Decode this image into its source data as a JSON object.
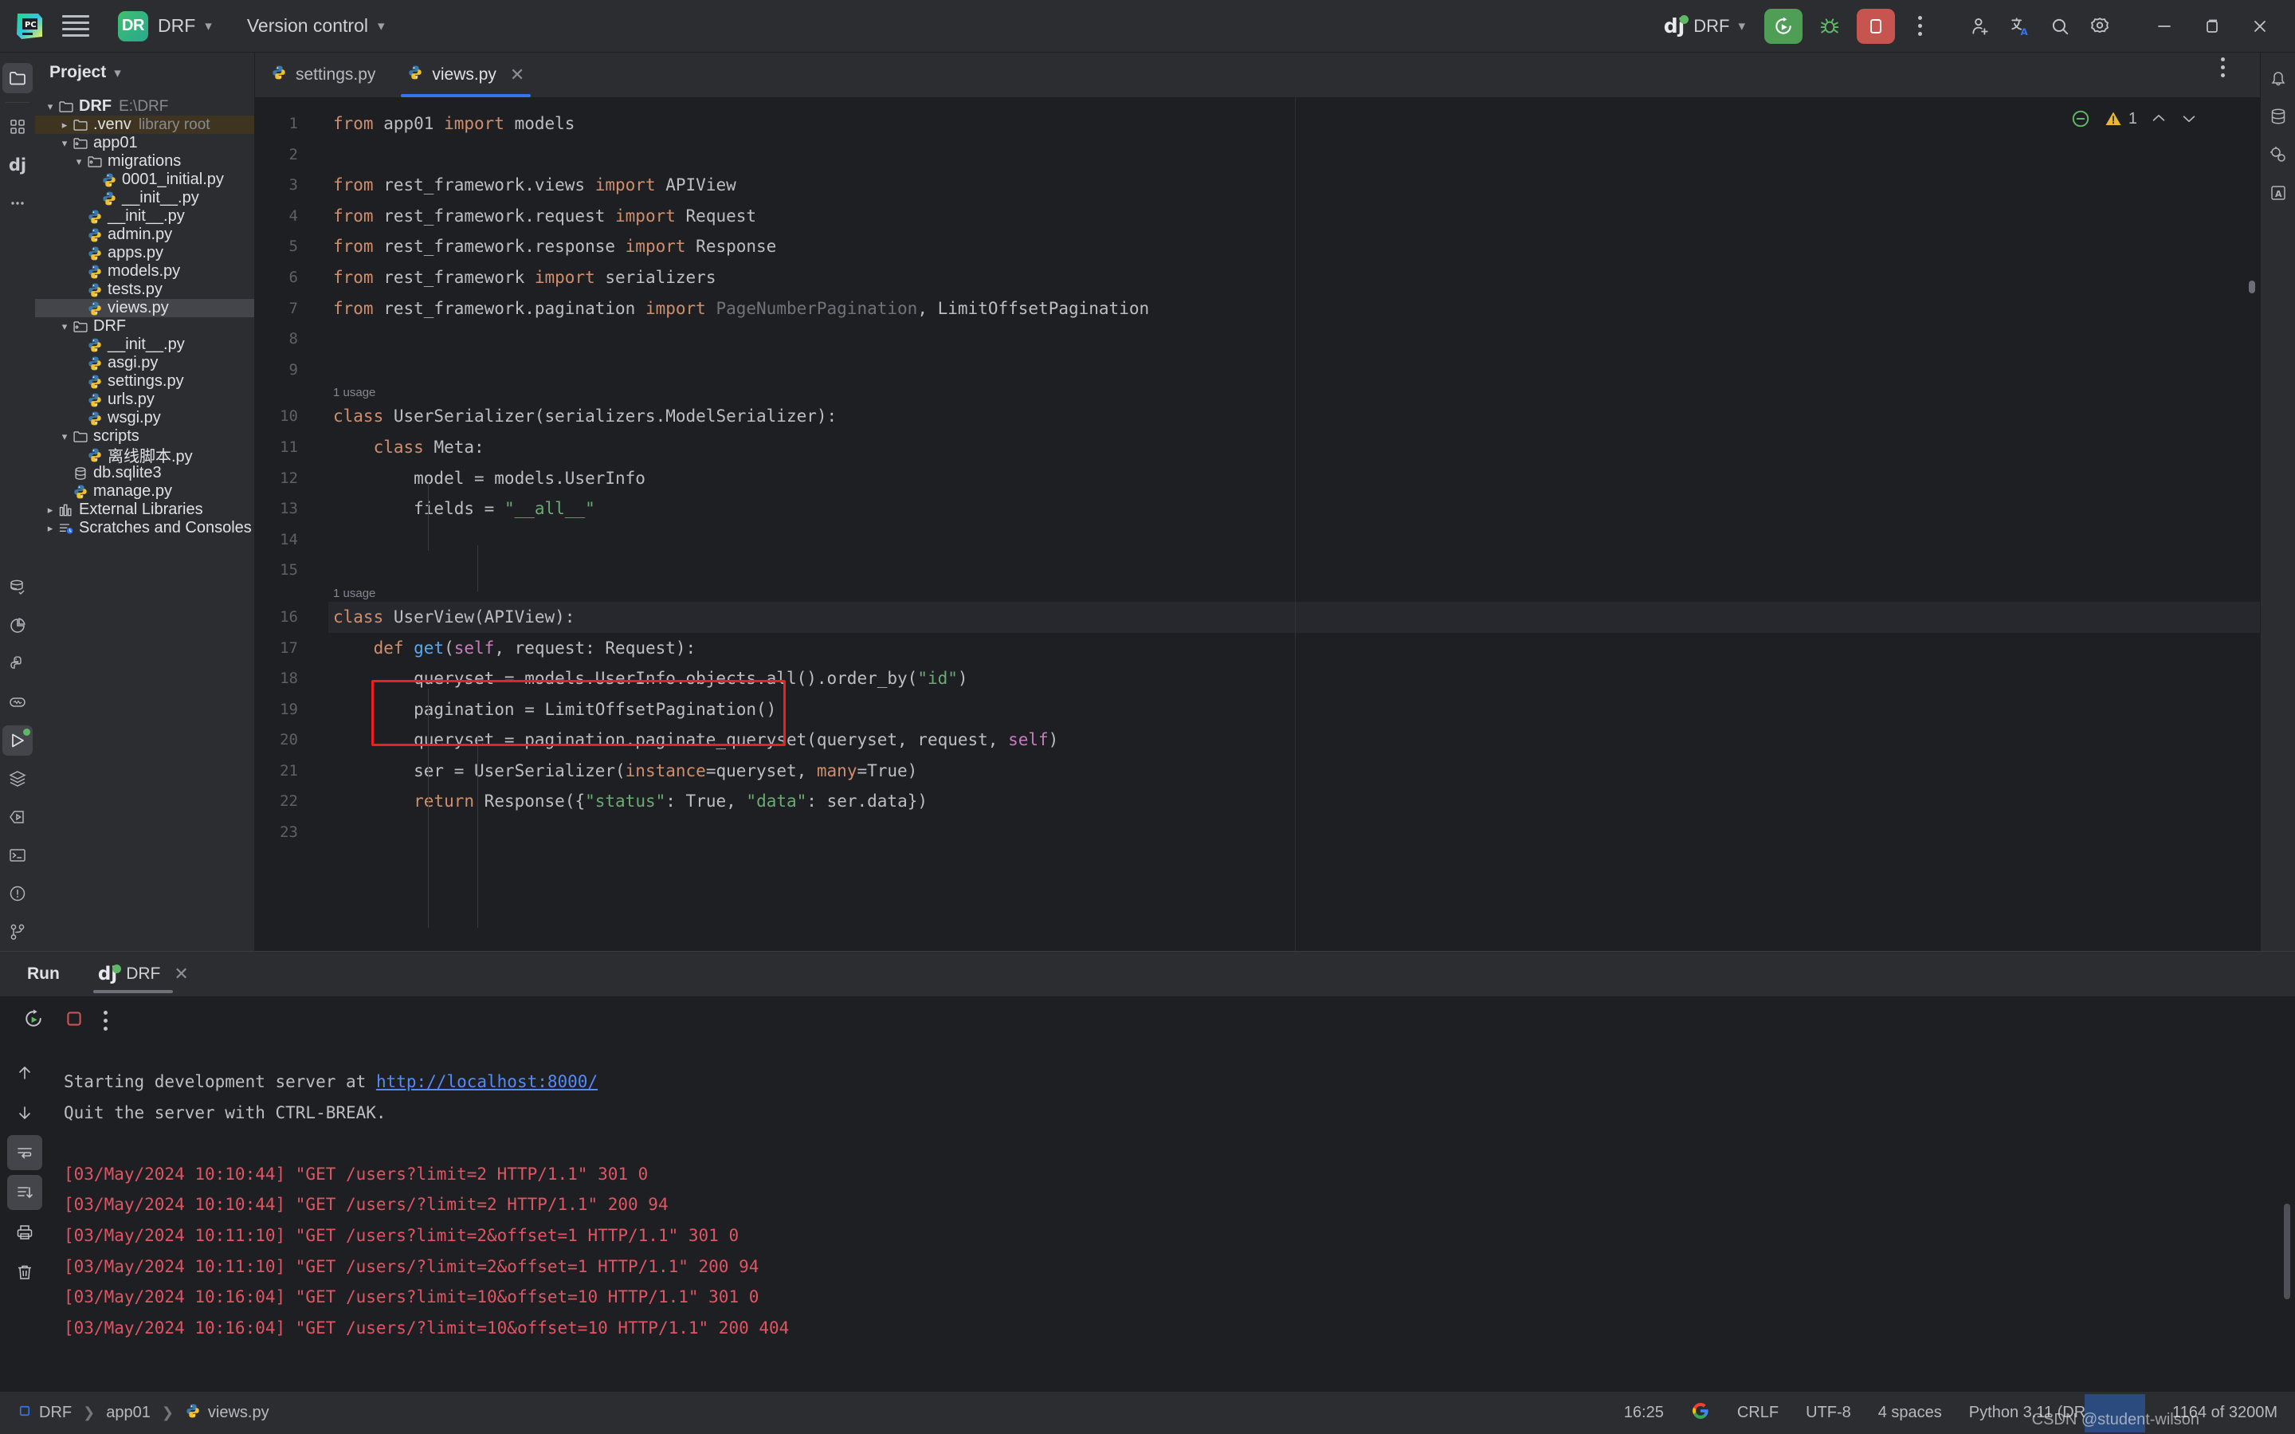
{
  "titlebar": {
    "menu_icon": "hamburger-icon",
    "logo_icon": "pycharm-logo-icon",
    "project_badge": "DR",
    "project_name": "DRF",
    "version_control": "Version control",
    "run_config_name": "DRF",
    "run_icon": "run-icon",
    "debug_icon": "debug-icon",
    "stop_icon": "stop-icon",
    "more_icon": "kebab-menu-icon",
    "add_user_icon": "add-user-icon",
    "translate_icon": "translate-icon",
    "search_icon": "search-icon",
    "settings_icon": "gear-icon",
    "minimize_icon": "minimize-icon",
    "maximize_icon": "maximize-icon",
    "close_icon": "close-icon"
  },
  "project_panel": {
    "title": "Project",
    "tree": [
      {
        "indent": 0,
        "arrow": "down",
        "icon": "folder",
        "label": "DRF",
        "sub": "E:\\DRF",
        "bold": true,
        "state": ""
      },
      {
        "indent": 1,
        "arrow": "right",
        "icon": "folder",
        "label": ".venv",
        "sub": "library root",
        "bold": false,
        "state": "hl"
      },
      {
        "indent": 1,
        "arrow": "down",
        "icon": "module",
        "label": "app01",
        "sub": "",
        "bold": false,
        "state": ""
      },
      {
        "indent": 2,
        "arrow": "down",
        "icon": "module",
        "label": "migrations",
        "sub": "",
        "bold": false,
        "state": ""
      },
      {
        "indent": 3,
        "arrow": "none",
        "icon": "python",
        "label": "0001_initial.py",
        "sub": "",
        "bold": false,
        "state": ""
      },
      {
        "indent": 3,
        "arrow": "none",
        "icon": "python",
        "label": "__init__.py",
        "sub": "",
        "bold": false,
        "state": ""
      },
      {
        "indent": 2,
        "arrow": "none",
        "icon": "python",
        "label": "__init__.py",
        "sub": "",
        "bold": false,
        "state": ""
      },
      {
        "indent": 2,
        "arrow": "none",
        "icon": "python",
        "label": "admin.py",
        "sub": "",
        "bold": false,
        "state": ""
      },
      {
        "indent": 2,
        "arrow": "none",
        "icon": "python",
        "label": "apps.py",
        "sub": "",
        "bold": false,
        "state": ""
      },
      {
        "indent": 2,
        "arrow": "none",
        "icon": "python",
        "label": "models.py",
        "sub": "",
        "bold": false,
        "state": ""
      },
      {
        "indent": 2,
        "arrow": "none",
        "icon": "python",
        "label": "tests.py",
        "sub": "",
        "bold": false,
        "state": ""
      },
      {
        "indent": 2,
        "arrow": "none",
        "icon": "python",
        "label": "views.py",
        "sub": "",
        "bold": false,
        "state": "sel"
      },
      {
        "indent": 1,
        "arrow": "down",
        "icon": "module",
        "label": "DRF",
        "sub": "",
        "bold": false,
        "state": ""
      },
      {
        "indent": 2,
        "arrow": "none",
        "icon": "python",
        "label": "__init__.py",
        "sub": "",
        "bold": false,
        "state": ""
      },
      {
        "indent": 2,
        "arrow": "none",
        "icon": "python",
        "label": "asgi.py",
        "sub": "",
        "bold": false,
        "state": ""
      },
      {
        "indent": 2,
        "arrow": "none",
        "icon": "python",
        "label": "settings.py",
        "sub": "",
        "bold": false,
        "state": ""
      },
      {
        "indent": 2,
        "arrow": "none",
        "icon": "python",
        "label": "urls.py",
        "sub": "",
        "bold": false,
        "state": ""
      },
      {
        "indent": 2,
        "arrow": "none",
        "icon": "python",
        "label": "wsgi.py",
        "sub": "",
        "bold": false,
        "state": ""
      },
      {
        "indent": 1,
        "arrow": "down",
        "icon": "folder",
        "label": "scripts",
        "sub": "",
        "bold": false,
        "state": ""
      },
      {
        "indent": 2,
        "arrow": "none",
        "icon": "python",
        "label": "离线脚本.py",
        "sub": "",
        "bold": false,
        "state": ""
      },
      {
        "indent": 1,
        "arrow": "none",
        "icon": "db",
        "label": "db.sqlite3",
        "sub": "",
        "bold": false,
        "state": ""
      },
      {
        "indent": 1,
        "arrow": "none",
        "icon": "python",
        "label": "manage.py",
        "sub": "",
        "bold": false,
        "state": ""
      },
      {
        "indent": 0,
        "arrow": "right",
        "icon": "library",
        "label": "External Libraries",
        "sub": "",
        "bold": false,
        "state": ""
      },
      {
        "indent": 0,
        "arrow": "right",
        "icon": "scratch",
        "label": "Scratches and Consoles",
        "sub": "",
        "bold": false,
        "state": ""
      }
    ]
  },
  "editor": {
    "tabs": [
      {
        "label": "settings.py",
        "active": false,
        "closable": false
      },
      {
        "label": "views.py",
        "active": true,
        "closable": true
      }
    ],
    "inspection_count": "1",
    "lines": [
      {
        "n": "1",
        "usage": "",
        "cur": false,
        "tokens": [
          {
            "t": "from ",
            "c": "kw"
          },
          {
            "t": "app01 ",
            "c": ""
          },
          {
            "t": "import ",
            "c": "kw"
          },
          {
            "t": "models",
            "c": ""
          }
        ]
      },
      {
        "n": "2",
        "usage": "",
        "cur": false,
        "tokens": []
      },
      {
        "n": "3",
        "usage": "",
        "cur": false,
        "tokens": [
          {
            "t": "from ",
            "c": "kw"
          },
          {
            "t": "rest_framework.views ",
            "c": ""
          },
          {
            "t": "import ",
            "c": "kw"
          },
          {
            "t": "APIView",
            "c": ""
          }
        ]
      },
      {
        "n": "4",
        "usage": "",
        "cur": false,
        "tokens": [
          {
            "t": "from ",
            "c": "kw"
          },
          {
            "t": "rest_framework.request ",
            "c": ""
          },
          {
            "t": "import ",
            "c": "kw"
          },
          {
            "t": "Request",
            "c": ""
          }
        ]
      },
      {
        "n": "5",
        "usage": "",
        "cur": false,
        "tokens": [
          {
            "t": "from ",
            "c": "kw"
          },
          {
            "t": "rest_framework.response ",
            "c": ""
          },
          {
            "t": "import ",
            "c": "kw"
          },
          {
            "t": "Response",
            "c": ""
          }
        ]
      },
      {
        "n": "6",
        "usage": "",
        "cur": false,
        "tokens": [
          {
            "t": "from ",
            "c": "kw"
          },
          {
            "t": "rest_framework ",
            "c": ""
          },
          {
            "t": "import ",
            "c": "kw"
          },
          {
            "t": "serializers",
            "c": ""
          }
        ]
      },
      {
        "n": "7",
        "usage": "",
        "cur": false,
        "tokens": [
          {
            "t": "from ",
            "c": "kw"
          },
          {
            "t": "rest_framework.pagination ",
            "c": ""
          },
          {
            "t": "import ",
            "c": "kw"
          },
          {
            "t": "PageNumberPagination",
            "c": "dim"
          },
          {
            "t": ", ",
            "c": ""
          },
          {
            "t": "LimitOffsetPagination",
            "c": ""
          }
        ]
      },
      {
        "n": "8",
        "usage": "",
        "cur": false,
        "tokens": []
      },
      {
        "n": "9",
        "usage": "",
        "cur": false,
        "tokens": []
      },
      {
        "n": "10",
        "usage": "1 usage",
        "cur": false,
        "tokens": [
          {
            "t": "class ",
            "c": "kw"
          },
          {
            "t": "UserSerializer(serializers.ModelSerializer):",
            "c": ""
          }
        ]
      },
      {
        "n": "11",
        "usage": "",
        "cur": false,
        "tokens": [
          {
            "t": "    ",
            "c": ""
          },
          {
            "t": "class ",
            "c": "kw"
          },
          {
            "t": "Meta:",
            "c": ""
          }
        ]
      },
      {
        "n": "12",
        "usage": "",
        "cur": false,
        "tokens": [
          {
            "t": "        model = models.UserInfo",
            "c": ""
          }
        ]
      },
      {
        "n": "13",
        "usage": "",
        "cur": false,
        "tokens": [
          {
            "t": "        fields = ",
            "c": ""
          },
          {
            "t": "\"__all__\"",
            "c": "str"
          }
        ]
      },
      {
        "n": "14",
        "usage": "",
        "cur": false,
        "tokens": []
      },
      {
        "n": "15",
        "usage": "",
        "cur": false,
        "tokens": []
      },
      {
        "n": "16",
        "usage": "1 usage",
        "cur": true,
        "tokens": [
          {
            "t": "class ",
            "c": "kw"
          },
          {
            "t": "UserView(APIView):",
            "c": ""
          }
        ]
      },
      {
        "n": "17",
        "usage": "",
        "cur": false,
        "tokens": [
          {
            "t": "    ",
            "c": ""
          },
          {
            "t": "def ",
            "c": "kw"
          },
          {
            "t": "get",
            "c": "fn"
          },
          {
            "t": "(",
            "c": ""
          },
          {
            "t": "self",
            "c": "self"
          },
          {
            "t": ", request: Request):",
            "c": ""
          }
        ]
      },
      {
        "n": "18",
        "usage": "",
        "cur": false,
        "tokens": [
          {
            "t": "        queryset = models.UserInfo.objects.all().order_by(",
            "c": ""
          },
          {
            "t": "\"id\"",
            "c": "str"
          },
          {
            "t": ")",
            "c": ""
          }
        ]
      },
      {
        "n": "19",
        "usage": "",
        "cur": false,
        "tokens": [
          {
            "t": "        pagination = LimitOffsetPagination()",
            "c": ""
          }
        ]
      },
      {
        "n": "20",
        "usage": "",
        "cur": false,
        "tokens": [
          {
            "t": "        queryset = pagination.paginate_queryset(queryset, request, ",
            "c": ""
          },
          {
            "t": "self",
            "c": "self"
          },
          {
            "t": ")",
            "c": ""
          }
        ]
      },
      {
        "n": "21",
        "usage": "",
        "cur": false,
        "tokens": [
          {
            "t": "        ser = UserSerializer(",
            "c": ""
          },
          {
            "t": "instance",
            "c": "kwarg"
          },
          {
            "t": "=queryset, ",
            "c": ""
          },
          {
            "t": "many",
            "c": "kwarg"
          },
          {
            "t": "=True)",
            "c": ""
          }
        ]
      },
      {
        "n": "22",
        "usage": "",
        "cur": false,
        "tokens": [
          {
            "t": "        ",
            "c": ""
          },
          {
            "t": "return ",
            "c": "kw"
          },
          {
            "t": "Response({",
            "c": ""
          },
          {
            "t": "\"status\"",
            "c": "str"
          },
          {
            "t": ": True, ",
            "c": ""
          },
          {
            "t": "\"data\"",
            "c": "str"
          },
          {
            "t": ": ser.data})",
            "c": ""
          }
        ]
      },
      {
        "n": "23",
        "usage": "",
        "cur": false,
        "tokens": []
      }
    ],
    "annotation": {
      "type": "red-rectangle",
      "covers_lines": [
        "19",
        "20"
      ],
      "color": "#f11e1e"
    }
  },
  "run_panel": {
    "title": "Run",
    "tab_label": "DRF",
    "toolbar": {
      "rerun_icon": "rerun-icon",
      "stop_icon": "stop-icon",
      "more_icon": "kebab-menu-icon"
    },
    "side_buttons": [
      "up-arrow-icon",
      "down-arrow-icon",
      "soft-wrap-icon",
      "scroll-to-end-icon",
      "print-icon",
      "trash-icon"
    ],
    "output": [
      {
        "text": "…",
        "style": "clipped"
      },
      {
        "text": "Starting development server at ",
        "style": "normal",
        "link": "http://localhost:8000/"
      },
      {
        "text": "Quit the server with CTRL-BREAK.",
        "style": "normal"
      },
      {
        "text": "",
        "style": "normal"
      },
      {
        "text": "[03/May/2024 10:10:44] \"GET /users?limit=2 HTTP/1.1\" 301 0",
        "style": "error"
      },
      {
        "text": "[03/May/2024 10:10:44] \"GET /users/?limit=2 HTTP/1.1\" 200 94",
        "style": "error"
      },
      {
        "text": "[03/May/2024 10:11:10] \"GET /users?limit=2&offset=1 HTTP/1.1\" 301 0",
        "style": "error"
      },
      {
        "text": "[03/May/2024 10:11:10] \"GET /users/?limit=2&offset=1 HTTP/1.1\" 200 94",
        "style": "error"
      },
      {
        "text": "[03/May/2024 10:16:04] \"GET /users?limit=10&offset=10 HTTP/1.1\" 301 0",
        "style": "error"
      },
      {
        "text": "[03/May/2024 10:16:04] \"GET /users/?limit=10&offset=10 HTTP/1.1\" 200 404",
        "style": "error"
      }
    ]
  },
  "status_bar": {
    "breadcrumb": [
      "DRF",
      "app01",
      "views.py"
    ],
    "time": "16:25",
    "google_icon": "google-icon",
    "line_separator": "CRLF",
    "encoding": "UTF-8",
    "indent": "4 spaces",
    "interpreter": "Python 3.11 (DRF)",
    "lock_icon": "lock-icon",
    "memory": "1164 of 3200M",
    "watermark": "CSDN @student-wilson"
  },
  "left_rail": [
    "project-icon",
    "structure-icon",
    "django-icon",
    "more-tools-icon"
  ],
  "left_rail_bottom": [
    "database-icon",
    "profiler-icon",
    "python-packages-icon",
    "notifications-widget-icon",
    "run-icon",
    "services-icon",
    "endpoints-icon",
    "terminal-icon",
    "problems-icon",
    "version-control-icon"
  ],
  "right_rail": [
    "notifications-icon",
    "database-icon",
    "ai-assistant-icon",
    "translation-icon"
  ]
}
